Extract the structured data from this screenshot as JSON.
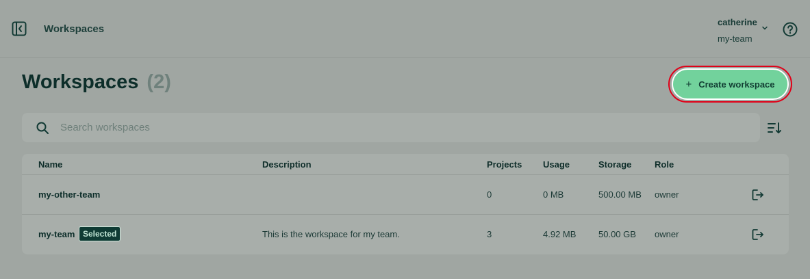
{
  "header": {
    "breadcrumb": "Workspaces",
    "user": {
      "name": "catherine",
      "team": "my-team"
    }
  },
  "page": {
    "title": "Workspaces",
    "count": "(2)",
    "create_button": "Create workspace",
    "create_plus": "+"
  },
  "search": {
    "placeholder": "Search workspaces",
    "value": ""
  },
  "table": {
    "columns": [
      "Name",
      "Description",
      "Projects",
      "Usage",
      "Storage",
      "Role"
    ],
    "rows": [
      {
        "name": "my-other-team",
        "badge": "",
        "description": "",
        "projects": "0",
        "usage": "0 MB",
        "storage": "500.00 MB",
        "role": "owner"
      },
      {
        "name": "my-team",
        "badge": "Selected",
        "description": "This is the workspace for my team.",
        "projects": "3",
        "usage": "4.92 MB",
        "storage": "50.00 GB",
        "role": "owner"
      }
    ]
  },
  "icons": {
    "sidebar_toggle": "sidebar-collapse-icon",
    "help": "help-circle-icon",
    "caret": "chevron-down-icon",
    "search": "search-icon",
    "sort": "sort-icon",
    "leave": "leave-workspace-icon"
  },
  "colors": {
    "accent": "#72d29c",
    "highlight_ring": "#e00018",
    "badge_bg": "#0f3b34"
  }
}
